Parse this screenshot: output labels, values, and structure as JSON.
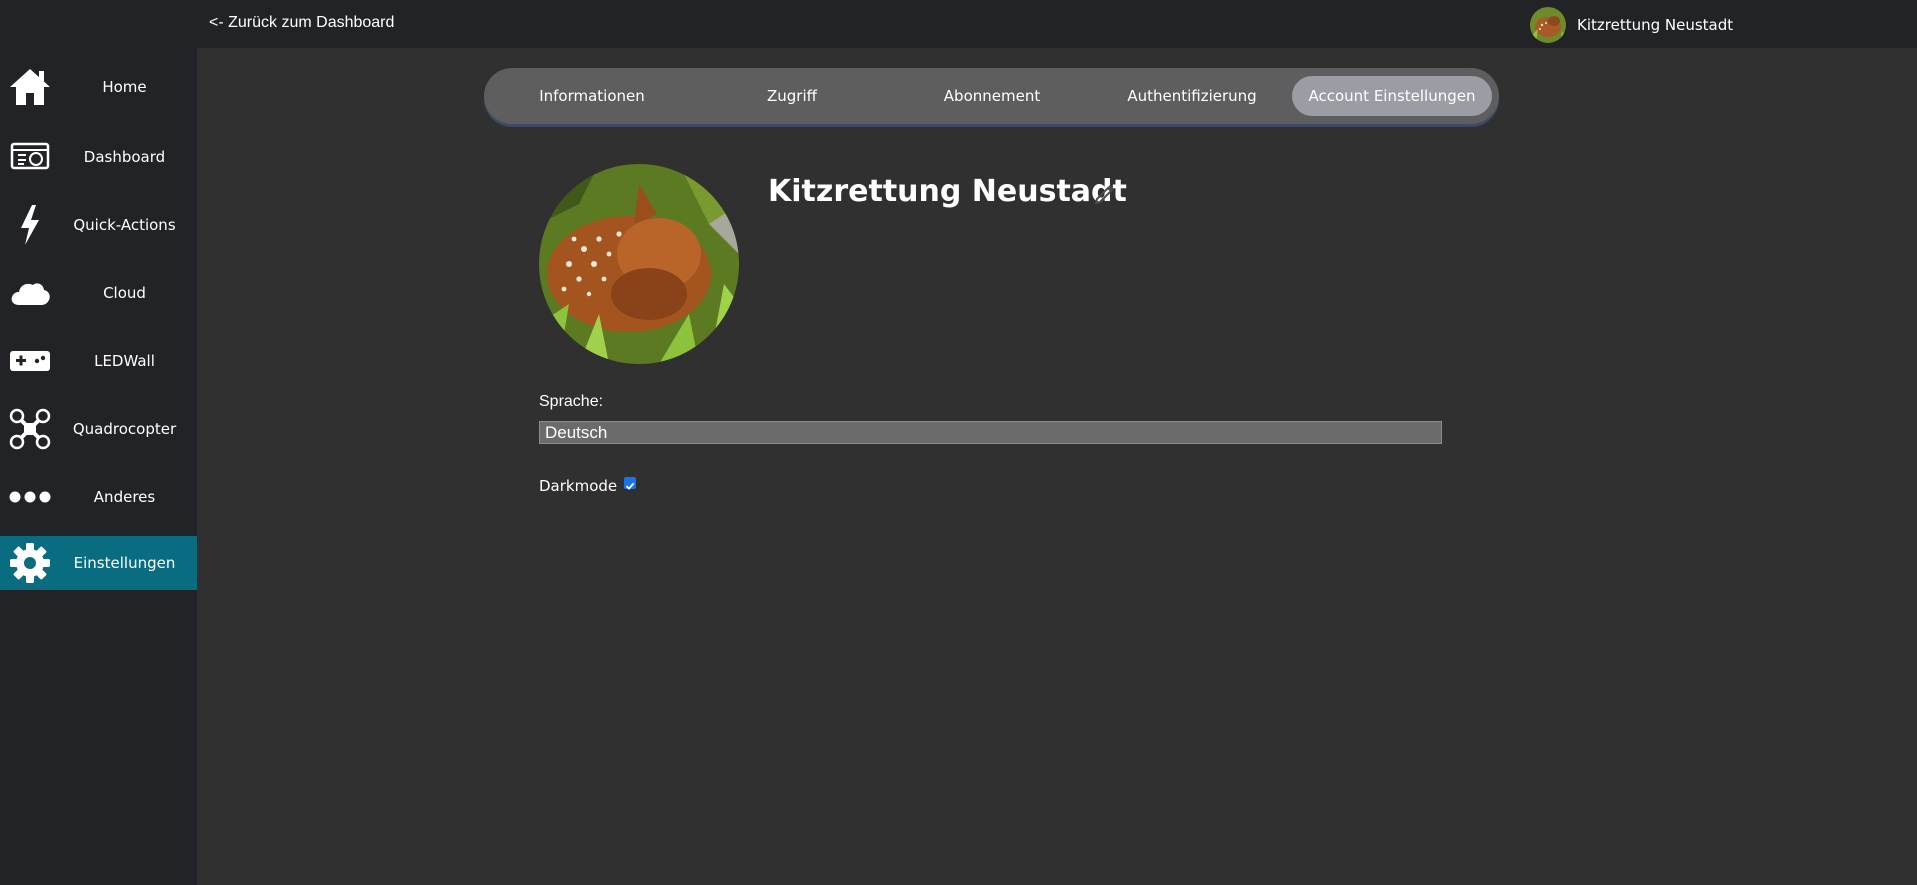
{
  "topbar": {
    "back_link": "<- Zurück zum Dashboard",
    "user_name": "Kitzrettung Neustadt"
  },
  "sidebar": {
    "items": [
      {
        "label": "Home",
        "icon": "home-icon"
      },
      {
        "label": "Dashboard",
        "icon": "dashboard-icon"
      },
      {
        "label": "Quick-Actions",
        "icon": "lightning-icon"
      },
      {
        "label": "Cloud",
        "icon": "cloud-icon"
      },
      {
        "label": "LEDWall",
        "icon": "gamepad-icon"
      },
      {
        "label": "Quadrocopter",
        "icon": "drone-icon"
      },
      {
        "label": "Anderes",
        "icon": "more-dots-icon"
      },
      {
        "label": "Einstellungen",
        "icon": "gear-icon",
        "active": true
      }
    ]
  },
  "tabs": [
    {
      "label": "Informationen"
    },
    {
      "label": "Zugriff"
    },
    {
      "label": "Abonnement"
    },
    {
      "label": "Authentifizierung"
    },
    {
      "label": "Account Einstellungen",
      "active": true
    }
  ],
  "profile": {
    "name": "Kitzrettung Neustadt"
  },
  "settings": {
    "language_label": "Sprache:",
    "language_value": "Deutsch",
    "darkmode_label": "Darkmode",
    "darkmode_checked": true
  },
  "colors": {
    "background": "#303030",
    "sidebar": "#222326",
    "active_nav": "#0a6c80",
    "tab_bar": "#5e5e5e",
    "active_tab": "#9a9da4",
    "checkbox": "#1a73e8"
  }
}
